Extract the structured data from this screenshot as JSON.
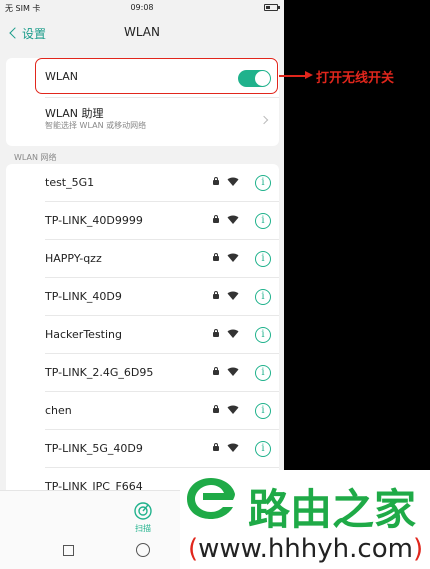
{
  "statusbar": {
    "carrier": "无 SIM 卡",
    "time": "09:08"
  },
  "navbar": {
    "back_label": "设置",
    "title": "WLAN"
  },
  "wlan_toggle": {
    "label": "WLAN",
    "state": "on"
  },
  "assistant": {
    "title": "WLAN 助理",
    "subtitle": "智能选择 WLAN 或移动网络"
  },
  "networks": {
    "header": "WLAN 网络",
    "items": [
      {
        "name": "test_5G1"
      },
      {
        "name": "TP-LINK_40D9999"
      },
      {
        "name": "HAPPY-qzz"
      },
      {
        "name": "TP-LINK_40D9"
      },
      {
        "name": "HackerTesting"
      },
      {
        "name": "TP-LINK_2.4G_6D95"
      },
      {
        "name": "chen"
      },
      {
        "name": "TP-LINK_5G_40D9"
      },
      {
        "name": "TP-LINK_IPC_F664"
      }
    ]
  },
  "bottombar": {
    "scan_label": "扫描"
  },
  "annotation": {
    "text": "打开无线开关"
  },
  "watermark": {
    "cn": "路由之家",
    "url_open": "(",
    "url": "www.hhhyh.com",
    "url_close": ")"
  },
  "colors": {
    "accent": "#20b28c",
    "annotation": "#e1261c",
    "watermark_green": "#1faa47"
  }
}
